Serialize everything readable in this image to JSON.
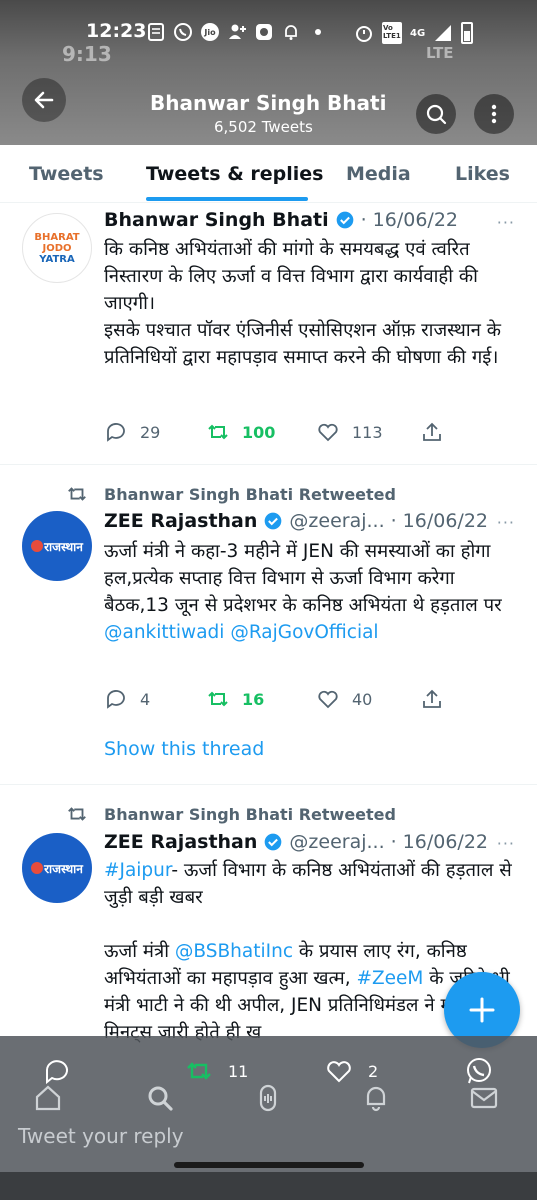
{
  "status_bar": {
    "time": "12:23",
    "ghost_time": "9:13",
    "ghost_network": "LTE",
    "network_label": "Vo LTE1",
    "signal": "4G"
  },
  "profile": {
    "name": "Bhanwar Singh Bhati",
    "tweet_count": "6,502 Tweets"
  },
  "tabs": [
    {
      "label": "Tweets"
    },
    {
      "label": "Tweets & replies"
    },
    {
      "label": "Media"
    },
    {
      "label": "Likes"
    }
  ],
  "tweets": [
    {
      "avatar_lines": [
        "BHARAT",
        "JODO",
        "YATRA"
      ],
      "name": "Bhanwar Singh Bhati",
      "separator": "·",
      "date": "16/06/22",
      "more": "···",
      "text_lines": [
        "कि कनिष्ठ अभियंताओं की मांगो के समयबद्ध एवं त्वरित निस्तारण के लिए ऊर्जा व वित्त विभाग द्वारा कार्यवाही की जाएगी।",
        "इसके पश्चात पॉवर एंजिनीर्स एसोसिएशन ऑफ़ राजस्थान के प्रतिनिधियों द्वारा महापड़ाव समाप्त करने की घोषणा की गई।"
      ],
      "replies": "29",
      "retweets": "100",
      "likes": "113"
    },
    {
      "retweeted_by": "Bhanwar Singh Bhati Retweeted",
      "avatar_label": "राजस्थान",
      "name": "ZEE Rajasthan",
      "handle": "@zeeraj...",
      "separator": "·",
      "date": "16/06/22",
      "more": "···",
      "text": "ऊर्जा मंत्री ने कहा-3 महीने में JEN की समस्याओं का होगा हल,प्रत्येक सप्ताह वित्त विभाग से ऊर्जा विभाग करेगा बैठक,13 जून से प्रदेशभर के कनिष्ठ अभियंता थे हड़ताल पर",
      "mentions": [
        "@ankittiwadi",
        "@RajGovOfficial"
      ],
      "replies": "4",
      "retweets": "16",
      "likes": "40",
      "show_thread": "Show this thread"
    },
    {
      "retweeted_by": "Bhanwar Singh Bhati Retweeted",
      "avatar_label": "राजस्थान",
      "name": "ZEE Rajasthan",
      "handle": "@zeeraj...",
      "separator": "·",
      "date": "16/06/22",
      "more": "···",
      "hashtag": "#Jaipur",
      "text_a": "- ऊर्जा विभाग के कनिष्ठ अभियंताओं की हड़ताल से जुड़ी बड़ी खबर",
      "text_b_pre": "ऊर्जा मंत्री ",
      "mention": "@BSBhatiInc",
      "text_b_mid": "  के प्रयास लाए रंग, कनिष्ठ अभियंताओं का महापड़ाव हुआ खत्म, ",
      "hashtag2": "#ZeeM",
      "text_b_post": " के जरिये भी मंत्री भाटी ने की थी अपील, JEN प्रतिनिधिमंडल ने मीटिंग मिनट्स जारी होते ही ख"
    }
  ],
  "overlay_actions": {
    "retweets": "11",
    "likes": "2"
  },
  "reply_box": {
    "placeholder": "Tweet your reply"
  },
  "colors": {
    "accent": "#1d9bf0",
    "retweet_green": "#17bf63",
    "secondary_text": "#536471"
  }
}
